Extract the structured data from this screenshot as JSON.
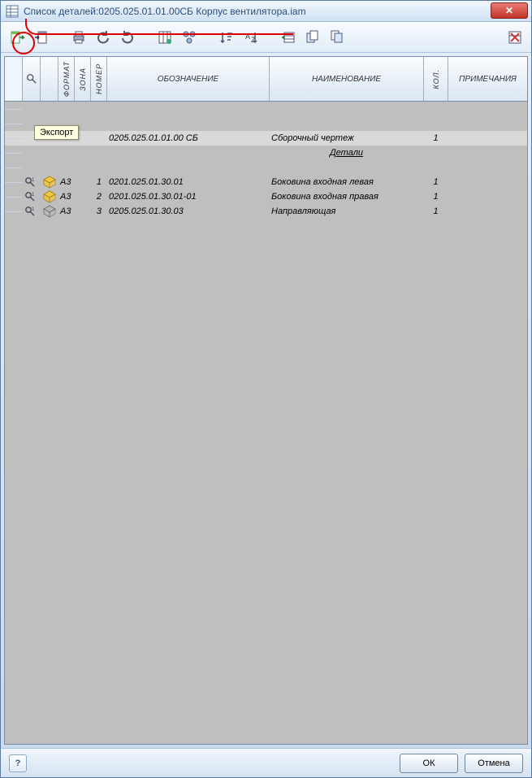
{
  "window": {
    "title_prefix": "Список деталей:",
    "title_doc": "0205.025.01.01.00СБ Корпус вентилятора.iam"
  },
  "tooltip": "Экспорт",
  "headers": {
    "format": "ФОРМАТ",
    "zone": "ЗОНА",
    "number": "НОМЕР",
    "designation": "ОБОЗНАЧЕНИЕ",
    "name": "НАИМЕНОВАНИЕ",
    "qty": "КОЛ.",
    "note": "ПРИМЕЧАНИЯ"
  },
  "group_row": {
    "designation": "0205.025.01.01.00 СБ",
    "name": "Сборочный чертеж",
    "qty": "1"
  },
  "sub_header": "Детали",
  "rows": [
    {
      "fmt": "А3",
      "num": "1",
      "des": "0201.025.01.30.01",
      "name": "Боковина входная левая",
      "qty": "1",
      "icon": "cube-yellow"
    },
    {
      "fmt": "А3",
      "num": "2",
      "des": "0201.025.01.30.01-01",
      "name": "Боковина входная правая",
      "qty": "1",
      "icon": "cube-yellow"
    },
    {
      "fmt": "А3",
      "num": "3",
      "des": "0205.025.01.30.03",
      "name": "Направляющая",
      "qty": "1",
      "icon": "cube-grey"
    }
  ],
  "footer": {
    "ok": "ОК",
    "cancel": "Отмена",
    "help": "?"
  }
}
